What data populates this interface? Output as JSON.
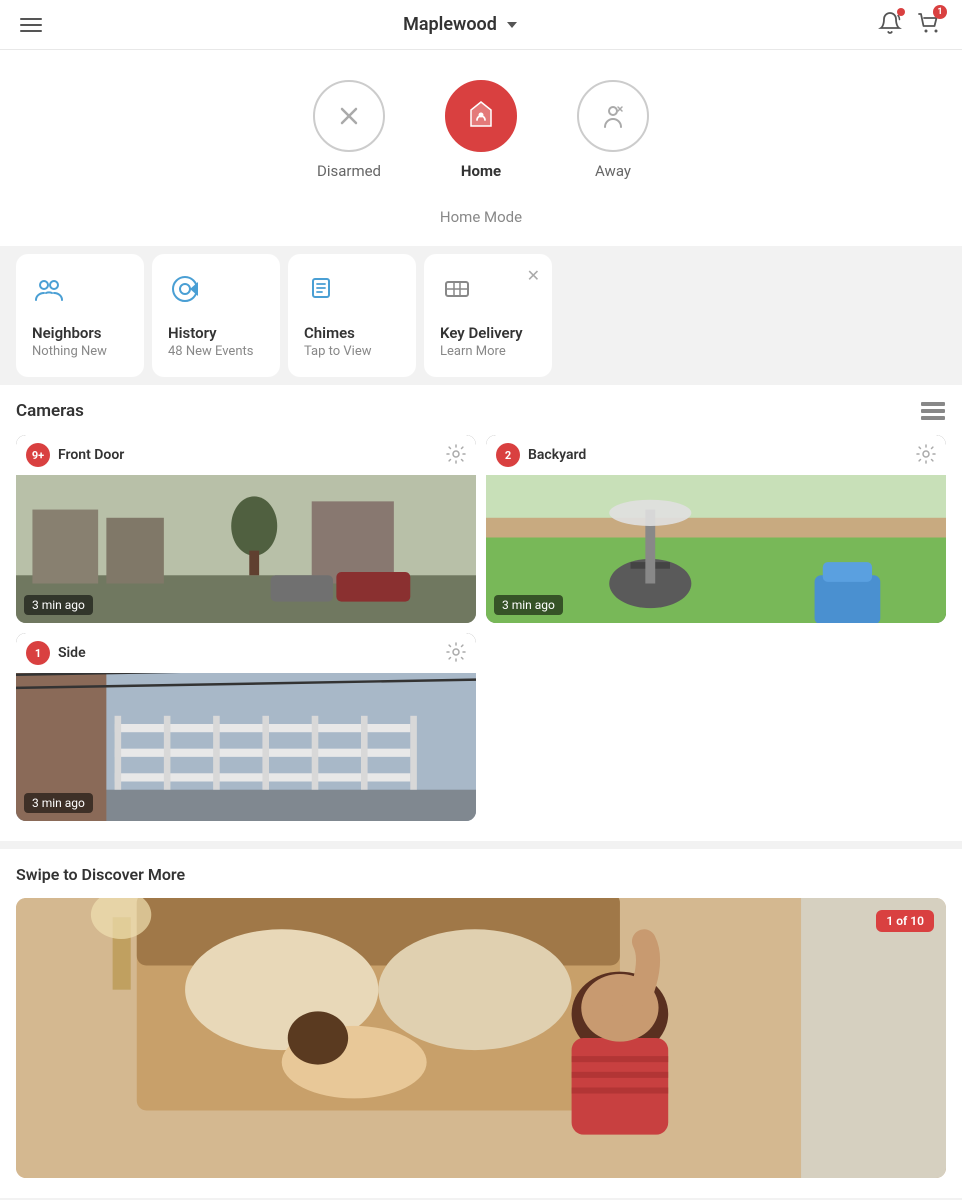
{
  "header": {
    "title": "Maplewood",
    "dropdown_label": "Maplewood"
  },
  "modes": {
    "options": [
      {
        "id": "disarmed",
        "label": "Disarmed",
        "active": false
      },
      {
        "id": "home",
        "label": "Home",
        "active": true
      },
      {
        "id": "away",
        "label": "Away",
        "active": false
      }
    ],
    "subtitle": "Home Mode"
  },
  "quick_access": [
    {
      "id": "neighbors",
      "title": "Neighbors",
      "subtitle": "Nothing New",
      "icon": "neighbors-icon"
    },
    {
      "id": "history",
      "title": "History",
      "subtitle": "48 New Events",
      "icon": "history-icon"
    },
    {
      "id": "chimes",
      "title": "Chimes",
      "subtitle": "Tap to View",
      "icon": "chimes-icon"
    },
    {
      "id": "key_delivery",
      "title": "Key Delivery",
      "subtitle": "Learn More",
      "icon": "key-delivery-icon",
      "dismissable": true
    }
  ],
  "cameras": {
    "section_title": "Cameras",
    "items": [
      {
        "id": "front_door",
        "name": "Front Door",
        "badge": "9+",
        "timestamp": "3 min ago"
      },
      {
        "id": "backyard",
        "name": "Backyard",
        "badge": "2",
        "timestamp": "3 min ago"
      },
      {
        "id": "side",
        "name": "Side",
        "badge": "1",
        "timestamp": "3 min ago"
      }
    ]
  },
  "discover": {
    "title": "Swipe to Discover More",
    "badge": "1 of 10"
  }
}
